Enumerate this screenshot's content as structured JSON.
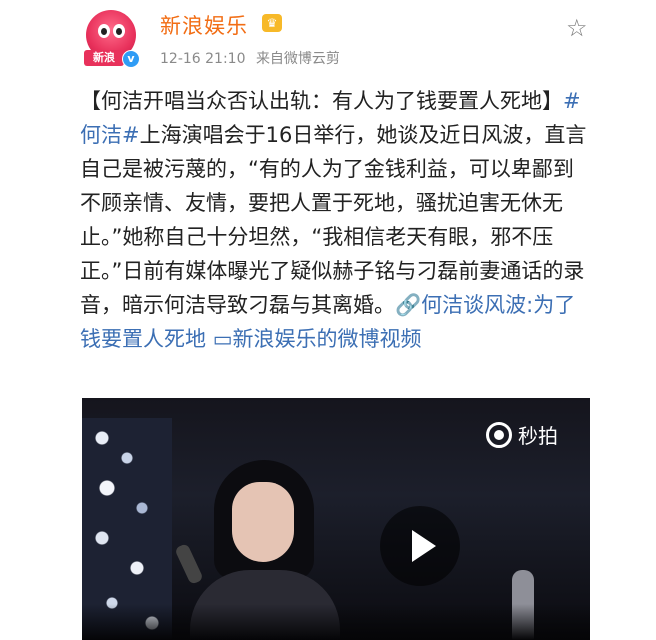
{
  "header": {
    "username": "新浪娱乐",
    "avatar_tag": "新浪",
    "timestamp": "12-16 21:10",
    "source": "来自微博云剪",
    "verified_badge": "v",
    "crown_badge": "♛"
  },
  "post": {
    "text_prefix": "【何洁开唱当众否认出轨：有人为了钱要置人死地】",
    "hashtag": "#何洁#",
    "text_main": "上海演唱会于16日举行，她谈及近日风波，直言自己是被污蔑的，“有的人为了金钱利益，可以卑鄙到不顾亲情、友情，要把人置于死地，骚扰迫害无休无止。”她称自己十分坦然，“我相信老天有眼，邪不压正。”日前有媒体曝光了疑似赫子铭与刁磊前妻通话的录音，暗示何洁导致刁磊与其离婚。",
    "link1": "🔗何洁谈风波:为了钱要置人死地",
    "link2": "▭新浪娱乐的微博视频"
  },
  "video": {
    "watermark": "秒拍"
  },
  "icons": {
    "star": "star-icon",
    "play": "play-icon",
    "link": "link-icon",
    "video": "video-icon"
  },
  "colors": {
    "username": "#f26d14",
    "link": "#3c6fb4",
    "verified": "#2f9cf5"
  }
}
